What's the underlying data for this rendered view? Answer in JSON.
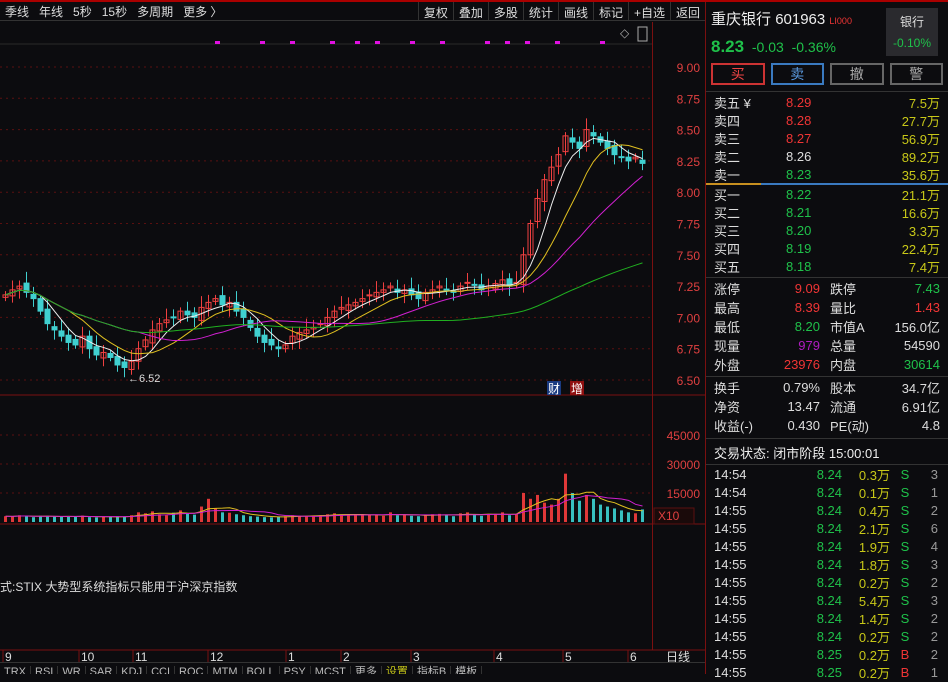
{
  "toolbar": {
    "left": [
      "季线",
      "年线",
      "5秒",
      "15秒",
      "多周期",
      "更多 〉"
    ],
    "right": [
      "复权",
      "叠加",
      "多股",
      "统计",
      "画线",
      "标记",
      "+自选",
      "返回"
    ]
  },
  "stock": {
    "name": "重庆银行",
    "code": "601963",
    "tag": "LI000",
    "price": "8.23",
    "change": "-0.03",
    "pct": "-0.36%",
    "sector": "银行",
    "sector_pct": "-0.10%"
  },
  "actions": [
    "买",
    "卖",
    "撤",
    "警"
  ],
  "asks": [
    {
      "label": "卖五 ¥",
      "price": "8.29",
      "vol": "7.5万",
      "c": "red"
    },
    {
      "label": "卖四",
      "price": "8.28",
      "vol": "27.7万",
      "c": "red"
    },
    {
      "label": "卖三",
      "price": "8.27",
      "vol": "56.9万",
      "c": "red"
    },
    {
      "label": "卖二",
      "price": "8.26",
      "vol": "89.2万",
      "c": "w"
    },
    {
      "label": "卖一",
      "price": "8.23",
      "vol": "35.6万",
      "c": "g"
    }
  ],
  "bids": [
    {
      "label": "买一",
      "price": "8.22",
      "vol": "21.1万",
      "c": "g"
    },
    {
      "label": "买二",
      "price": "8.21",
      "vol": "16.6万",
      "c": "g"
    },
    {
      "label": "买三",
      "price": "8.20",
      "vol": "3.3万",
      "c": "g"
    },
    {
      "label": "买四",
      "price": "8.19",
      "vol": "22.4万",
      "c": "g"
    },
    {
      "label": "买五",
      "price": "8.18",
      "vol": "7.4万",
      "c": "g"
    }
  ],
  "stats1": [
    [
      "涨停",
      "9.09",
      "red",
      "跌停",
      "7.43",
      "g"
    ],
    [
      "最高",
      "8.39",
      "red",
      "量比",
      "1.43",
      "red"
    ],
    [
      "最低",
      "8.20",
      "g",
      "市值A",
      "156.0亿",
      "w"
    ],
    [
      "现量",
      "979",
      "pur",
      "总量",
      "54590",
      "w"
    ],
    [
      "外盘",
      "23976",
      "red",
      "内盘",
      "30614",
      "g"
    ]
  ],
  "stats2": [
    [
      "换手",
      "0.79%",
      "w",
      "股本",
      "34.7亿",
      "w"
    ],
    [
      "净资",
      "13.47",
      "w",
      "流通",
      "6.91亿",
      "w"
    ],
    [
      "收益(-)",
      "0.430",
      "w",
      "PE(动)",
      "4.8",
      "w"
    ]
  ],
  "trade_status": "交易状态: 闭市阶段 15:00:01",
  "ticks": [
    [
      "14:54",
      "8.24",
      "0.3万",
      "S",
      "3"
    ],
    [
      "14:54",
      "8.24",
      "0.1万",
      "S",
      "1"
    ],
    [
      "14:55",
      "8.24",
      "0.4万",
      "S",
      "2"
    ],
    [
      "14:55",
      "8.24",
      "2.1万",
      "S",
      "6"
    ],
    [
      "14:55",
      "8.24",
      "1.9万",
      "S",
      "4"
    ],
    [
      "14:55",
      "8.24",
      "1.8万",
      "S",
      "3"
    ],
    [
      "14:55",
      "8.24",
      "0.2万",
      "S",
      "2"
    ],
    [
      "14:55",
      "8.24",
      "5.4万",
      "S",
      "3"
    ],
    [
      "14:55",
      "8.24",
      "1.4万",
      "S",
      "2"
    ],
    [
      "14:55",
      "8.24",
      "0.2万",
      "S",
      "2"
    ],
    [
      "14:55",
      "8.25",
      "0.2万",
      "B",
      "2"
    ],
    [
      "14:55",
      "8.25",
      "0.2万",
      "B",
      "1"
    ]
  ],
  "chart": {
    "price_ticks": [
      "9.00",
      "8.75",
      "8.50",
      "8.25",
      "8.00",
      "7.75",
      "7.50",
      "7.25",
      "7.00",
      "6.75",
      "6.50"
    ],
    "vol_ticks": [
      "45000",
      "30000",
      "15000"
    ],
    "vol_unit": "X10",
    "low_mark": "←6.52",
    "badge_fin": "财",
    "badge_add": "增",
    "indicator_note": "式:STIX 大势型系统指标只能用于沪深京指数",
    "months": [
      "9",
      "10",
      "11",
      "12",
      "1",
      "2",
      "3",
      "4",
      "5",
      "6"
    ],
    "period": "日线",
    "closes": [
      7.18,
      7.22,
      7.25,
      7.2,
      7.15,
      7.05,
      6.95,
      6.9,
      6.85,
      6.8,
      6.78,
      6.85,
      6.75,
      6.7,
      6.72,
      6.68,
      6.62,
      6.6,
      6.65,
      6.75,
      6.82,
      6.9,
      6.95,
      6.98,
      7.0,
      7.05,
      7.02,
      7.0,
      7.08,
      7.12,
      7.15,
      7.1,
      7.12,
      7.05,
      7.0,
      6.92,
      6.85,
      6.8,
      6.78,
      6.75,
      6.78,
      6.85,
      6.88,
      6.9,
      6.92,
      6.95,
      7.0,
      7.05,
      7.08,
      7.1,
      7.12,
      7.15,
      7.18,
      7.2,
      7.22,
      7.25,
      7.2,
      7.22,
      7.18,
      7.15,
      7.2,
      7.22,
      7.25,
      7.22,
      7.2,
      7.25,
      7.28,
      7.26,
      7.22,
      7.25,
      7.27,
      7.3,
      7.25,
      7.28,
      7.5,
      7.75,
      7.95,
      8.1,
      8.2,
      8.3,
      8.45,
      8.4,
      8.35,
      8.5,
      8.45,
      8.4,
      8.35,
      8.3,
      8.28,
      8.25,
      8.28,
      8.23
    ],
    "volumes": [
      3000,
      2800,
      3500,
      3000,
      2500,
      3200,
      3000,
      2800,
      2600,
      3000,
      2700,
      3300,
      2500,
      2400,
      2600,
      2800,
      3000,
      2700,
      3500,
      5000,
      4500,
      5500,
      4000,
      3500,
      4800,
      6000,
      4500,
      3800,
      8000,
      12000,
      7000,
      5000,
      4800,
      4000,
      3500,
      3000,
      2800,
      2500,
      2400,
      2600,
      3000,
      3500,
      3200,
      3000,
      3300,
      3500,
      4000,
      4500,
      3800,
      3500,
      3600,
      4000,
      3800,
      3500,
      3200,
      5000,
      3500,
      3800,
      3200,
      3000,
      3600,
      4000,
      4200,
      3500,
      3000,
      4500,
      5000,
      3800,
      3200,
      3800,
      4200,
      5000,
      3500,
      4000,
      15000,
      12000,
      14000,
      10000,
      9000,
      12000,
      25000,
      15000,
      11000,
      14000,
      12000,
      9000,
      8000,
      7000,
      6000,
      5000,
      4500,
      6500
    ],
    "tabs": [
      "TRX",
      "RSI",
      "WR",
      "SAR",
      "KDJ",
      "CCI",
      "ROC",
      "MTM",
      "BOLL",
      "PSY",
      "MCST",
      "更多",
      "设置",
      "指标B",
      "模板"
    ]
  }
}
